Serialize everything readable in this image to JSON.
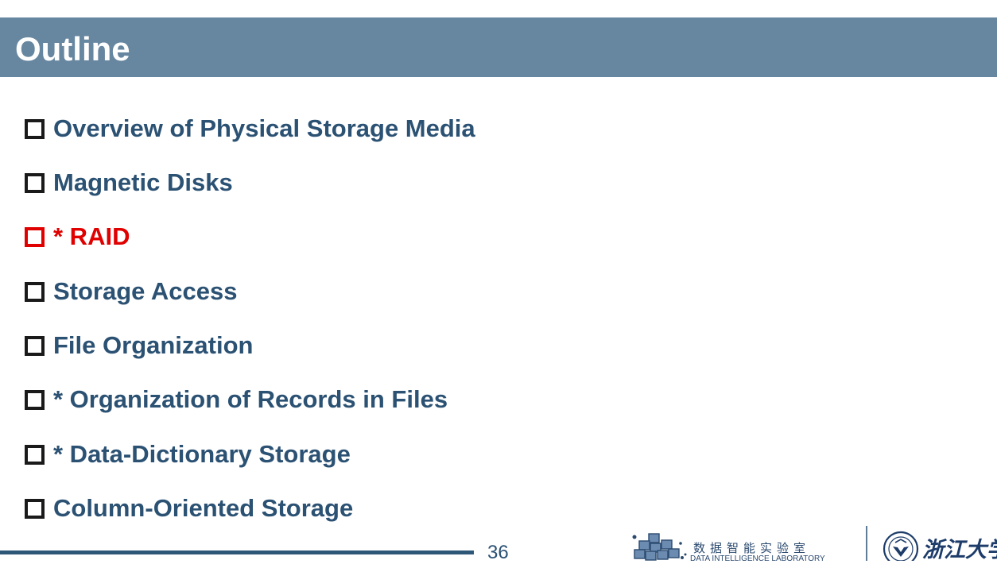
{
  "slide": {
    "title": "Outline",
    "page_number": "36"
  },
  "outline": {
    "items": [
      {
        "label": "Overview of Physical Storage Media",
        "active": false
      },
      {
        "label": "Magnetic Disks",
        "active": false
      },
      {
        "label": "* RAID",
        "active": true
      },
      {
        "label": "Storage Access",
        "active": false
      },
      {
        "label": "File Organization",
        "active": false
      },
      {
        "label": "* Organization of Records in Files",
        "active": false
      },
      {
        "label": "* Data-Dictionary Storage",
        "active": false
      },
      {
        "label": "Column-Oriented Storage",
        "active": false
      }
    ]
  },
  "footer": {
    "lab_name_cn": "数据智能实验室",
    "lab_name_en": "DATA INTELLIGENCE LABORATORY",
    "university_name": "浙江大学"
  },
  "colors": {
    "title_bar": "#6786a0",
    "item_text": "#2b5173",
    "active_item": "#e00000",
    "footer_rule": "#2e5677"
  }
}
